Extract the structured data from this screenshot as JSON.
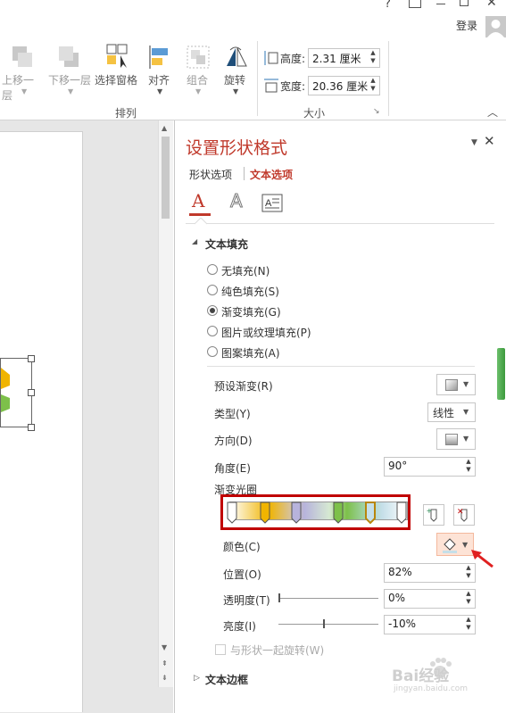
{
  "title_bar": {
    "help": "?",
    "login": "登录"
  },
  "ribbon": {
    "move_up": "上移一层",
    "move_down": "下移一层",
    "selection_pane": "选择窗格",
    "align": "对齐",
    "group": "组合",
    "rotate": "旋转",
    "arrange_group_label": "排列",
    "height_label": "高度:",
    "height_value": "2.31 厘米",
    "width_label": "宽度:",
    "width_value": "20.36 厘米",
    "size_group_label": "大小"
  },
  "pane": {
    "title": "设置形状格式",
    "tabs": [
      "形状选项",
      "文本选项"
    ],
    "active_tab": 1,
    "section_text_fill": "文本填充",
    "fill_options": [
      {
        "label": "无填充(N)",
        "selected": false
      },
      {
        "label": "纯色填充(S)",
        "selected": false
      },
      {
        "label": "渐变填充(G)",
        "selected": true
      },
      {
        "label": "图片或纹理填充(P)",
        "selected": false
      },
      {
        "label": "图案填充(A)",
        "selected": false
      }
    ],
    "preset_gradient_label": "预设渐变(R)",
    "type_label": "类型(Y)",
    "type_value": "线性",
    "direction_label": "方向(D)",
    "angle_label": "角度(E)",
    "angle_value": "90°",
    "gradient_stops_label": "渐变光圈",
    "color_label": "颜色(C)",
    "position_label": "位置(O)",
    "position_value": "82%",
    "transparency_label": "透明度(T)",
    "transparency_value": "0%",
    "transparency_level": 0,
    "brightness_label": "亮度(I)",
    "brightness_value": "-10%",
    "brightness_level": -10,
    "rotate_with_shape": "与形状一起旋转(W)",
    "section_text_border": "文本边框",
    "gradient_stop_colors": [
      "#ffffff",
      "#f0b400",
      "#b7b3dc",
      "#7dc04a",
      "#c5dfe9",
      "#ffffff"
    ],
    "highlight_color": "#c00000",
    "accent_color": "#c0392b"
  },
  "watermark": {
    "text": "Bai经验",
    "sub": "jingyan.baidu.com"
  }
}
